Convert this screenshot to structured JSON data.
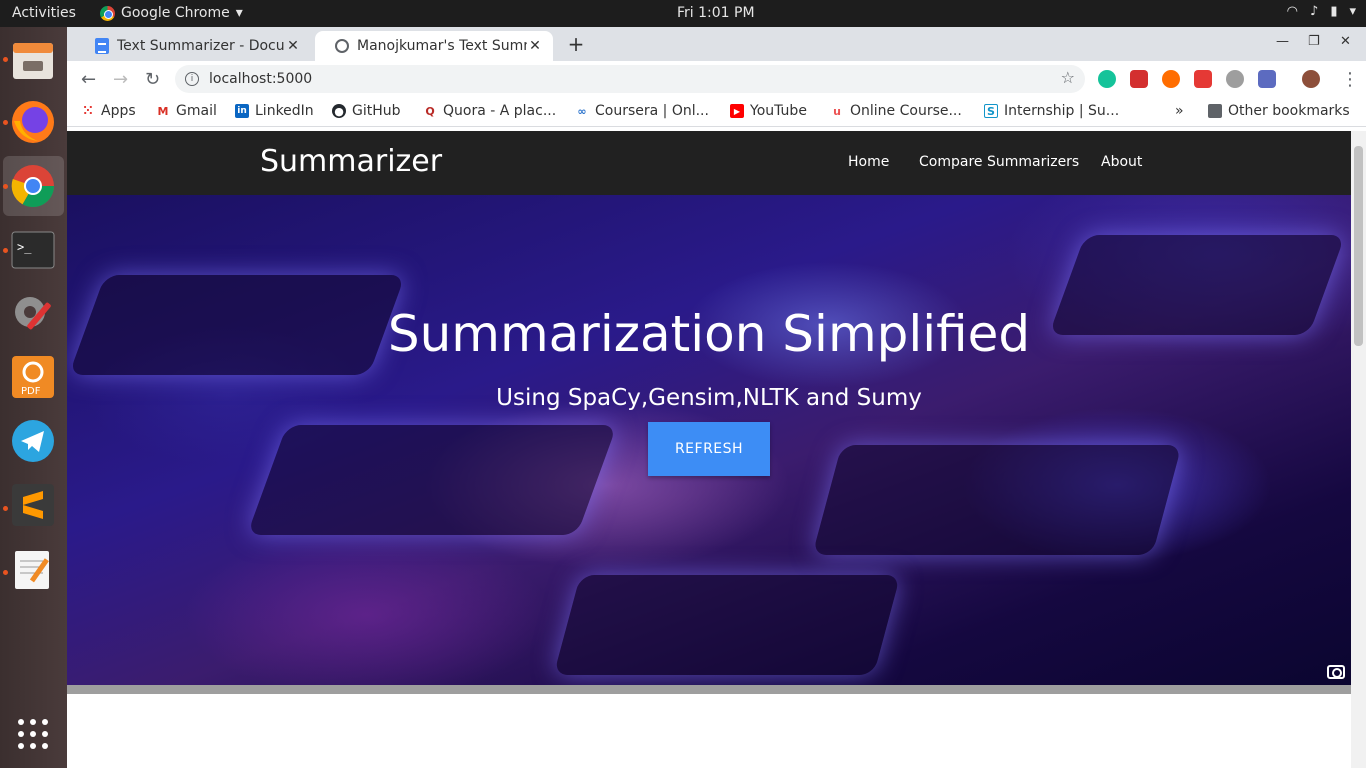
{
  "system": {
    "activities": "Activities",
    "app_name": "Google Chrome",
    "clock": "Fri  1:01 PM"
  },
  "dock": {
    "items": [
      "files-icon",
      "firefox-icon",
      "chrome-icon",
      "terminal-icon",
      "settings-icon",
      "pdf-editor-icon",
      "telegram-icon",
      "sublime-text-icon",
      "text-editor-icon",
      "show-apps-icon"
    ]
  },
  "tabs": [
    {
      "label": "Text Summarizer - Docum",
      "icon": "docs-icon",
      "active": false
    },
    {
      "label": "Manojkumar's Text Summ",
      "icon": "globe-icon",
      "active": true
    }
  ],
  "toolbar": {
    "url": "localhost:5000"
  },
  "bookmarks": [
    {
      "label": "Apps",
      "icon": "apps-grid-icon"
    },
    {
      "label": "Gmail",
      "icon": "gmail-icon"
    },
    {
      "label": "LinkedIn",
      "icon": "linkedin-icon"
    },
    {
      "label": "GitHub",
      "icon": "github-icon"
    },
    {
      "label": "Quora - A plac...",
      "icon": "quora-icon"
    },
    {
      "label": "Coursera | Onl...",
      "icon": "coursera-icon"
    },
    {
      "label": "YouTube",
      "icon": "youtube-icon"
    },
    {
      "label": "Online Course...",
      "icon": "udemy-icon"
    },
    {
      "label": "Internship | Su...",
      "icon": "internshala-icon"
    },
    {
      "label": "Other bookmarks",
      "icon": "folder-icon"
    }
  ],
  "site": {
    "brand": "Summarizer",
    "nav": [
      "Home",
      "Compare Summarizers",
      "About"
    ],
    "hero_title": "Summarization Simplified",
    "hero_subtitle": "Using SpaCy,Gensim,NLTK and Sumy",
    "refresh_label": "REFRESH"
  },
  "colors": {
    "navbar": "#212121",
    "button": "#3d8df5",
    "ubuntu_accent": "#e95420"
  }
}
